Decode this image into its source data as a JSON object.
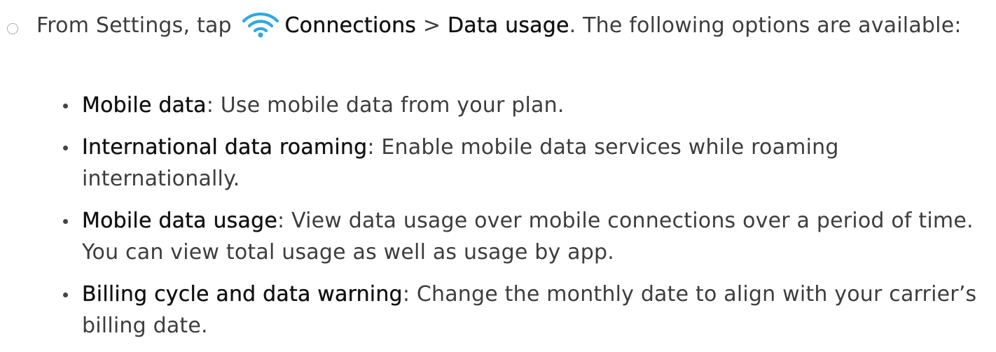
{
  "step": {
    "prefix": "From Settings, tap",
    "icon": "wifi-icon",
    "icon_color": "#2fa8e0",
    "term_connections": "Connections",
    "separator": ">",
    "term_data_usage": "Data usage",
    "suffix": ". The following options are available:"
  },
  "options": [
    {
      "term": "Mobile data",
      "description": ": Use mobile data from your plan."
    },
    {
      "term": "International data roaming",
      "description": ": Enable mobile data services while roaming internationally."
    },
    {
      "term": "Mobile data usage",
      "description": ": View data usage over mobile connections over a period of time. You can view total usage as well as usage by app."
    },
    {
      "term": "Billing cycle and data warning",
      "description": ": Change the monthly date to align with your carrier’s billing date."
    }
  ]
}
